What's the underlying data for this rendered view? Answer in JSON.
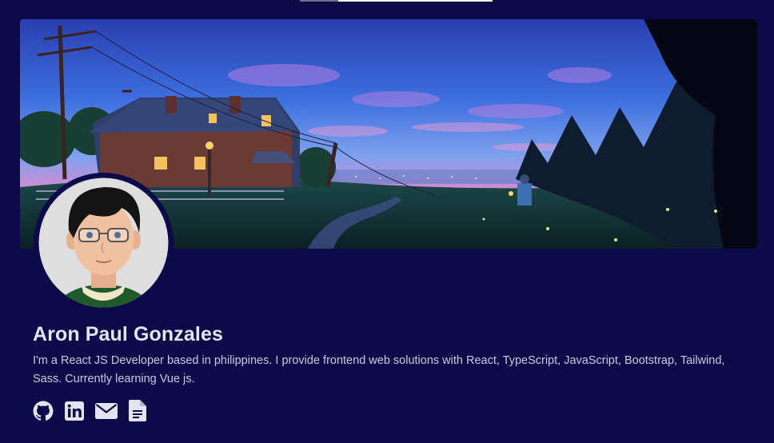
{
  "profile": {
    "name": "Aron Paul Gonzales",
    "bio": "I'm a React JS Developer based in philippines. I provide frontend web solutions with React, TypeScript, JavaScript, Bootstrap, Tailwind, Sass. Currently learning Vue js."
  },
  "social_links": [
    {
      "icon": "github-icon"
    },
    {
      "icon": "linkedin-icon"
    },
    {
      "icon": "envelope-icon"
    },
    {
      "icon": "document-icon"
    }
  ],
  "colors": {
    "background": "#0c0a48",
    "name_text": "#e4e4f0",
    "bio_text": "#c9c9df",
    "icon": "#e4e4f0"
  }
}
